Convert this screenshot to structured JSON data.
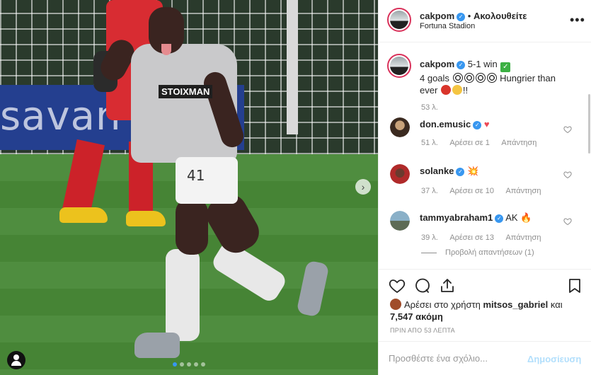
{
  "post": {
    "username": "cakpom",
    "follow_separator": "•",
    "follow_state": "Ακολουθείτε",
    "location": "Fortuna Stadion",
    "more": "•••",
    "photo": {
      "board_text": "savan",
      "sponsor_text": "STOIXMAN",
      "shorts_number": "41",
      "carousel_slide_count": 5,
      "carousel_active_index": 0
    }
  },
  "caption": {
    "username": "cakpom",
    "line1": "5-1 win",
    "line2_prefix": "4 goals",
    "line2_suffix": "Hungrier than",
    "line3_suffix": "!!",
    "time": "53 λ."
  },
  "comments": [
    {
      "username": "don.emusic",
      "verified": true,
      "text": "",
      "emoji": "♥",
      "time": "51 λ.",
      "likes": "Αρέσει σε 1",
      "reply": "Απάντηση"
    },
    {
      "username": "solanke",
      "verified": true,
      "text": "",
      "emoji": "💥",
      "time": "37 λ.",
      "likes": "Αρέσει σε 10",
      "reply": "Απάντηση"
    },
    {
      "username": "tammyabraham1",
      "verified": true,
      "text": "AK",
      "emoji": "🔥",
      "time": "39 λ.",
      "likes": "Αρέσει σε 13",
      "reply": "Απάντηση"
    }
  ],
  "view_replies": "Προβολή απαντήσεων (1)",
  "likes_prefix": "Αρέσει στο χρήστη",
  "liker": "mitsos_gabriel",
  "likes_and": "και",
  "likes_count": "7,547 ακόμη",
  "timestamp": "ΠΡΙΝ ΑΠΟ 53 ΛΕΠΤΑ",
  "add_comment": {
    "placeholder": "Προσθέστε ένα σχόλιο...",
    "post_label": "Δημοσίευση"
  },
  "colors": {
    "accent": "#3897f0",
    "post_disabled": "#b2dffc",
    "muted": "#8e8e8e",
    "heart": "#ed4956",
    "check": "#3cb043"
  }
}
